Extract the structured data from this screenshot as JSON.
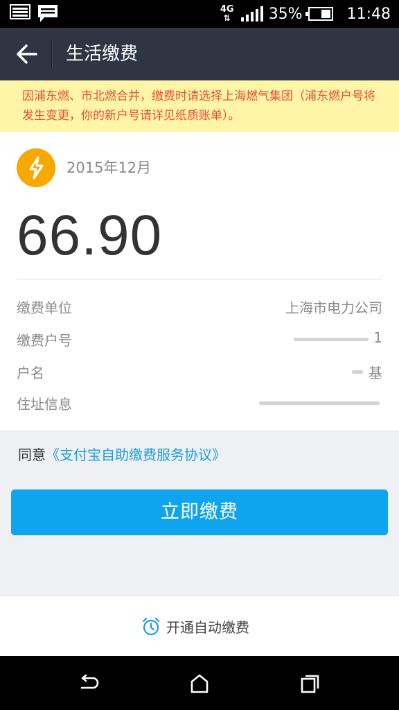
{
  "status_bar": {
    "network": "4G",
    "battery": "35%",
    "time": "11:48"
  },
  "header": {
    "title": "生活缴费"
  },
  "notice": {
    "text": "因浦东燃、市北燃合并，缴费时请选择上海燃气集团（浦东燃户号将发生变更，你的新户号请详见纸质账单）。"
  },
  "bill": {
    "icon": "lightning-icon",
    "period": "2015年12月",
    "amount": "66.90",
    "rows": [
      {
        "label": "缴费单位",
        "value": "上海市电力公司"
      },
      {
        "label": "缴费户号",
        "value": "1"
      },
      {
        "label": "户名",
        "value": "基"
      },
      {
        "label": "住址信息",
        "value": ""
      }
    ]
  },
  "agreement": {
    "prefix": "同意",
    "link": "《支付宝自助缴费服务协议》"
  },
  "pay_button": {
    "label": "立即缴费"
  },
  "auto_pay": {
    "icon": "alarm-clock-icon",
    "label": "开通自动缴费"
  },
  "colors": {
    "header_bg": "#2e3644",
    "notice_bg": "#fef6a6",
    "notice_text": "#e94b3c",
    "accent": "#0ea5ee",
    "icon_bg": "#f8a800",
    "link": "#1a9de2"
  }
}
